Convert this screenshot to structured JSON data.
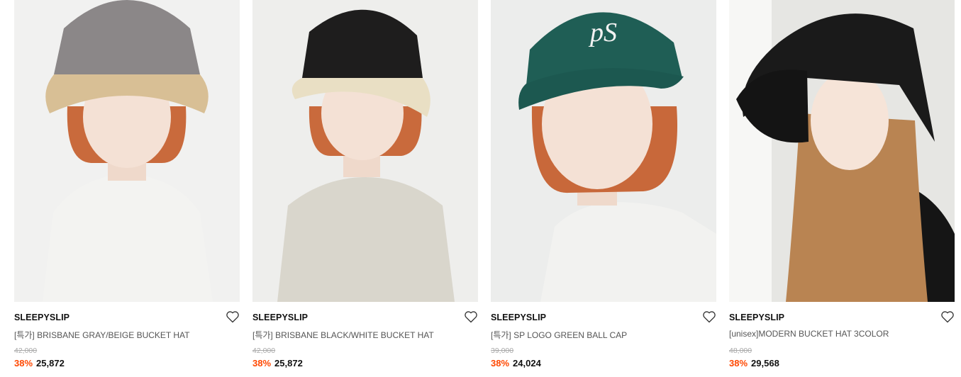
{
  "products": [
    {
      "brand": "SLEEPYSLIP",
      "name": "[특가] BRISBANE GRAY/BEIGE BUCKET HAT",
      "original_price": "42,000",
      "discount": "38%",
      "price": "25,872",
      "wishlist_icon": "heart-outline-icon",
      "colors": {
        "background": "#f1f1f0",
        "hat": "#8b8788",
        "brim": "#d8bf95",
        "top": "#f3f3f1",
        "hair": "#c96a3c"
      }
    },
    {
      "brand": "SLEEPYSLIP",
      "name": "[특가] BRISBANE BLACK/WHITE BUCKET HAT",
      "original_price": "42,000",
      "discount": "38%",
      "price": "25,872",
      "wishlist_icon": "heart-outline-icon",
      "colors": {
        "background": "#eeeeec",
        "hat": "#1e1d1d",
        "brim": "#e9dfc4",
        "top": "#d9d6cc",
        "hair": "#c96a3c"
      }
    },
    {
      "brand": "SLEEPYSLIP",
      "name": "[특가] SP LOGO GREEN BALL CAP",
      "original_price": "39,000",
      "discount": "38%",
      "price": "24,024",
      "wishlist_icon": "heart-outline-icon",
      "colors": {
        "background": "#ecedec",
        "hat": "#1f5e55",
        "brim": "#1c5850",
        "top": "#f2f2f0",
        "hair": "#c8683a"
      }
    },
    {
      "brand": "SLEEPYSLIP",
      "name": "[unisex]MODERN BUCKET HAT 3COLOR",
      "original_price": "48,000",
      "discount": "38%",
      "price": "29,568",
      "wishlist_icon": "heart-outline-icon",
      "colors": {
        "background": "#e6e6e3",
        "hat": "#1a1a1a",
        "brim": "#141414",
        "top": "#151515",
        "hair": "#b98452"
      }
    }
  ]
}
